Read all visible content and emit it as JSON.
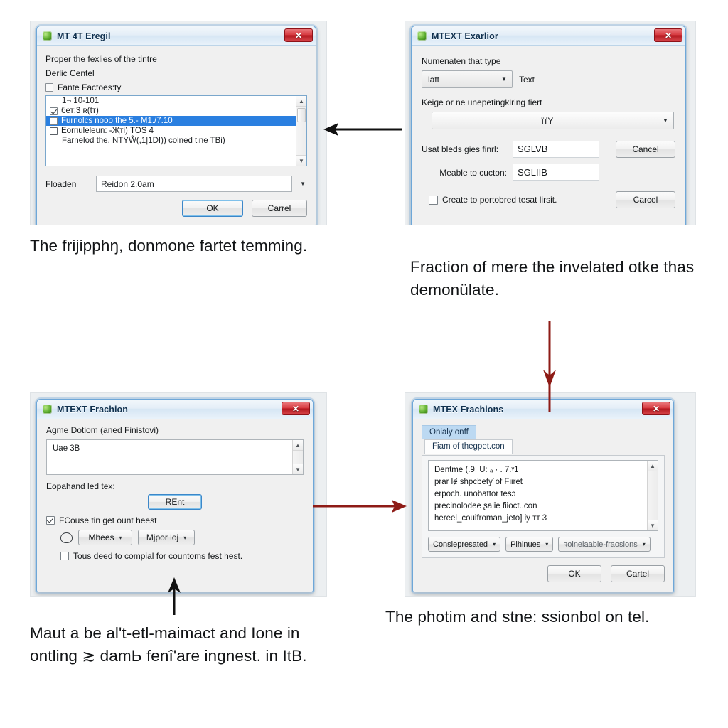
{
  "page": {
    "background": "#ffffff",
    "arrow_black": "#111111",
    "arrow_red": "#8e1b16",
    "accent_blue": "#2a7fe0",
    "titlebar_blue": "#d6e6f4",
    "close_red": "#c22a30"
  },
  "panels": {
    "top_left": {
      "window": {
        "title": "MT 4T Eregil",
        "icon": "autocad-app-icon",
        "close_label": "✕"
      },
      "body": {
        "heading": "Proper the fexlies of the tintre",
        "subheading": "Derlic Centel",
        "group_label": "Fante Factoes:ty",
        "list_items": [
          {
            "checkbox": "none",
            "text": "1¬ 10-101",
            "selected": false
          },
          {
            "checkbox": "checked",
            "text": "бет:3  ʀ(tт)",
            "selected": false
          },
          {
            "checkbox": "blank",
            "text": "Furnolcs nooo  the  5.- М1./7.10",
            "selected": true
          },
          {
            "checkbox": "ghost",
            "text": "Eorriuleleun: -Җті)  TOS 4",
            "selected": false
          },
          {
            "checkbox": "none",
            "text": "Farnelod the. NTYŴ(,1|1DI)) colned tine  TBі)",
            "selected": false
          }
        ],
        "bottom_field_label": "Floaden",
        "bottom_field_value": "Reidon 2.0am",
        "ok_label": "OK",
        "cancel_label": "Carrel"
      },
      "caption": "The frijipphŋ, donmone fartet temming."
    },
    "top_right": {
      "window": {
        "title": "MTEXT Exarlior",
        "icon": "autocad-app-icon",
        "close_label": "✕"
      },
      "body": {
        "heading": "Numenaten that type",
        "combo_value": "latt",
        "combo_side_label": "Text",
        "subheading": "Keige or ne unepetingklring fiert",
        "wide_combo_value": "їїY",
        "field1_label": "Usat bleds gies finrl:",
        "field1_value": "SGLVB",
        "field2_label": "Meable to cucton:",
        "field2_value": "SGLІIB",
        "checkbox_label": "Create to portobred tesat lirsit.",
        "button1_label": "Cancel",
        "button2_label": "Carcel"
      },
      "caption": "Fraction of mere the invelated otke thas demonülate."
    },
    "bottom_left": {
      "window": {
        "title": "MTEXT Frachion",
        "icon": "autocad-app-icon",
        "close_label": "✕"
      },
      "body": {
        "heading": "Agme Dotiom (aned Finistovi)",
        "textarea_value": "Uae 3B",
        "sub_label": "Eopahand led tex:",
        "main_button_label": "REnt",
        "checkbox1_label": "FCouse tin get ount heest",
        "dropdown1_label": "Mhees",
        "dropdown2_label": "Mjpor loj",
        "checkbox2_label": "Tous deed to compial for countoms fest hest."
      },
      "caption": "Maut a be al't-etl-maimact and Ione in ontling ≳ damЬ fenî'are ingnest. in ItB."
    },
    "bottom_right": {
      "window": {
        "title": "MTEX Frachions",
        "icon": "autocad-app-icon",
        "close_label": "✕"
      },
      "body": {
        "tab_back_label": "Onialy onff",
        "tab_front_label": "Fiam of thegpet.con",
        "text_lines": [
          "Dentme (.9ː Uː ₐ · . 7.ʸ1",
          "prar lɇ shpcbety´of Fiiret",
          "erpoch. unobattor tesɔ",
          "precinolodee ʂalie fiioct..con",
          "hereel_couifroman_jeto] iy тт 3"
        ],
        "toolbar_buttons": [
          "Consiepresated",
          "Plhinues",
          "ʀoinelaable-fraosions"
        ],
        "ok_label": "OK",
        "cancel_label": "Cartel"
      },
      "caption": "The photim and stne: ssionbol on tel."
    }
  },
  "arrows": [
    {
      "name": "arrow-top-right-to-top-left",
      "direction": "left",
      "color": "#111111"
    },
    {
      "name": "arrow-top-right-down",
      "direction": "down",
      "color": "#8e1b16"
    },
    {
      "name": "arrow-bottom-left-to-bottom-right",
      "direction": "right",
      "color": "#8e1b16"
    },
    {
      "name": "arrow-caption-to-bottom-left",
      "direction": "up",
      "color": "#111111"
    }
  ]
}
